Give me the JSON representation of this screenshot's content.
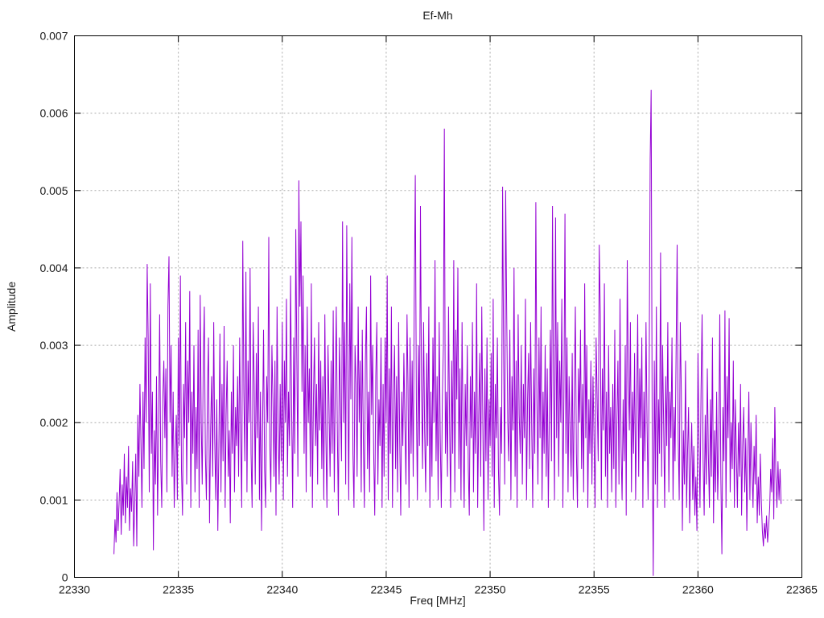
{
  "chart_data": {
    "type": "line",
    "title": "Ef-Mh",
    "xlabel": "Freq [MHz]",
    "ylabel": "Amplitude",
    "xlim": [
      22330,
      22365
    ],
    "ylim": [
      0,
      0.007
    ],
    "xticks": [
      22330,
      22335,
      22340,
      22345,
      22350,
      22355,
      22360,
      22365
    ],
    "xtick_labels": [
      "22330",
      "22335",
      "22340",
      "22345",
      "22350",
      "22355",
      "22360",
      "22365"
    ],
    "yticks": [
      0,
      0.001,
      0.002,
      0.003,
      0.004,
      0.005,
      0.006,
      0.007
    ],
    "ytick_labels": [
      "0",
      "0.001",
      "0.002",
      "0.003",
      "0.004",
      "0.005",
      "0.006",
      "0.007"
    ],
    "grid": true,
    "legend_position": "none",
    "line_color": "#9400D3",
    "grid_color": "#AAAAAA",
    "border_color": "#000000",
    "series": [
      {
        "name": "Ef-Mh",
        "x_start": 22331.9,
        "x_step": 0.05,
        "value_scale": 1e-05,
        "values": [
          30,
          75,
          45,
          110,
          60,
          95,
          140,
          55,
          120,
          80,
          160,
          70,
          130,
          90,
          170,
          60,
          115,
          85,
          150,
          40,
          95,
          160,
          40,
          210,
          130,
          250,
          170,
          90,
          240,
          140,
          310,
          200,
          405,
          305,
          110,
          380,
          160,
          240,
          35,
          190,
          120,
          260,
          80,
          190,
          340,
          150,
          90,
          230,
          280,
          180,
          270,
          110,
          350,
          415,
          200,
          300,
          130,
          240,
          90,
          160,
          210,
          100,
          310,
          170,
          390,
          140,
          80,
          250,
          180,
          330,
          120,
          280,
          200,
          370,
          90,
          240,
          160,
          300,
          110,
          220,
          140,
          320,
          90,
          365,
          200,
          120,
          280,
          350,
          160,
          100,
          240,
          310,
          70,
          190,
          260,
          130,
          330,
          180,
          100,
          230,
          60,
          170,
          315,
          110,
          250,
          150,
          325,
          90,
          210,
          280,
          130,
          190,
          70,
          240,
          160,
          300,
          110,
          220,
          170,
          260,
          130,
          310,
          180,
          90,
          435,
          240,
          150,
          395,
          110,
          280,
          200,
          400,
          160,
          90,
          330,
          250,
          120,
          290,
          180,
          350,
          100,
          240,
          60,
          180,
          320,
          140,
          90,
          260,
          200,
          440,
          170,
          110,
          300,
          230,
          130,
          280,
          80,
          350,
          190,
          120,
          250,
          150,
          330,
          100,
          280,
          200,
          360,
          130,
          240,
          170,
          390,
          220,
          90,
          310,
          160,
          450,
          280,
          130,
          513,
          350,
          460,
          240,
          390,
          160,
          300,
          110,
          350,
          200,
          270,
          130,
          380,
          90,
          230,
          310,
          170,
          250,
          120,
          330,
          190,
          280,
          140,
          260,
          100,
          340,
          180,
          90,
          300,
          220,
          130,
          280,
          160,
          345,
          110,
          240,
          350,
          190,
          80,
          310,
          230,
          150,
          460,
          200,
          330,
          120,
          455,
          280,
          100,
          380,
          230,
          440,
          160,
          90,
          300,
          250,
          130,
          350,
          200,
          280,
          110,
          320,
          180,
          90,
          280,
          350,
          140,
          240,
          110,
          390,
          210,
          300,
          160,
          80,
          260,
          330,
          120,
          230,
          170,
          310,
          90,
          250,
          130,
          310,
          200,
          390,
          100,
          270,
          160,
          350,
          90,
          230,
          300,
          140,
          260,
          110,
          330,
          180,
          80,
          240,
          170,
          290,
          200,
          120,
          340,
          250,
          90,
          310,
          160,
          280,
          130,
          360,
          520,
          230,
          100,
          300,
          170,
          480,
          250,
          140,
          330,
          190,
          110,
          290,
          170,
          350,
          90,
          240,
          130,
          310,
          200,
          410,
          150,
          260,
          100,
          330,
          180,
          90,
          230,
          300,
          580,
          160,
          240,
          130,
          350,
          200,
          90,
          280,
          160,
          410,
          110,
          320,
          230,
          400,
          140,
          270,
          100,
          330,
          190,
          90,
          250,
          170,
          300,
          140,
          80,
          260,
          180,
          330,
          110,
          240,
          160,
          380,
          90,
          210,
          290,
          130,
          350,
          200,
          60,
          270,
          150,
          310,
          100,
          230,
          170,
          290,
          130,
          360,
          90,
          250,
          180,
          310,
          140,
          80,
          220,
          160,
          505,
          280,
          120,
          500,
          340,
          200,
          150,
          320,
          100,
          260,
          190,
          400,
          130,
          280,
          90,
          340,
          210,
          160,
          300,
          120,
          250,
          180,
          360,
          100,
          230,
          290,
          140,
          330,
          200,
          90,
          270,
          160,
          485,
          230,
          120,
          310,
          180,
          350,
          100,
          240,
          160,
          300,
          130,
          270,
          90,
          210,
          320,
          150,
          480,
          250,
          100,
          465,
          180,
          330,
          130,
          280,
          200,
          360,
          90,
          240,
          470,
          160,
          310,
          110,
          260,
          190,
          130,
          290,
          100,
          240,
          350,
          160,
          90,
          270,
          200,
          320,
          140,
          250,
          110,
          380,
          180,
          300,
          90,
          230,
          160,
          280,
          120,
          260,
          180,
          90,
          310,
          230,
          150,
          430,
          340,
          100,
          270,
          190,
          380,
          130,
          240,
          90,
          300,
          160,
          220,
          110,
          250,
          140,
          320,
          90,
          200,
          280,
          120,
          360,
          170,
          100,
          230,
          150,
          300,
          80,
          410,
          260,
          190,
          330,
          110,
          240,
          160,
          290,
          100,
          220,
          340,
          130,
          270,
          180,
          310,
          90,
          240,
          150,
          330,
          200,
          100,
          260,
          540,
          630,
          190,
          2,
          280,
          120,
          350,
          90,
          230,
          160,
          420,
          130,
          300,
          200,
          90,
          260,
          170,
          330,
          110,
          240,
          180,
          310,
          100,
          220,
          150,
          290,
          430,
          180,
          100,
          330,
          240,
          60,
          190,
          120,
          280,
          90,
          160,
          220,
          70,
          140,
          200,
          100,
          170,
          80,
          130,
          60,
          290,
          180,
          90,
          240,
          340,
          150,
          80,
          210,
          120,
          270,
          160,
          90,
          230,
          130,
          310,
          70,
          190,
          110,
          240,
          100,
          170,
          340,
          130,
          30,
          220,
          150,
          345,
          90,
          260,
          180,
          335,
          110,
          200,
          140,
          280,
          90,
          230,
          160,
          90,
          200,
          130,
          250,
          80,
          170,
          220,
          110,
          180,
          60,
          150,
          240,
          100,
          200,
          140,
          90,
          170,
          120,
          210,
          70,
          130,
          80,
          160,
          100,
          60,
          40,
          70,
          50,
          80,
          45,
          65,
          90,
          140,
          110,
          180,
          75,
          220,
          130,
          90,
          150,
          100,
          140,
          95
        ]
      }
    ]
  }
}
